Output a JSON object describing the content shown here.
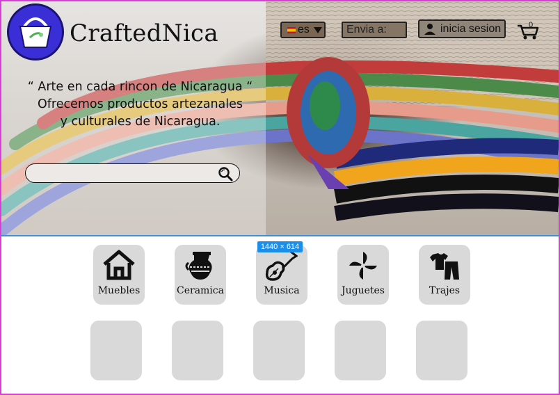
{
  "brand": {
    "name": "CraftedNica"
  },
  "header": {
    "language": "es",
    "ship_to_placeholder": "Envia a:",
    "login_label": "inicia sesion",
    "cart_count": "0"
  },
  "hero": {
    "tagline_line1": "“ Arte en cada rincon  de Nicaragua “",
    "tagline_line2": "Ofrecemos productos  artezanales",
    "tagline_line3": "y culturales de Nicaragua.",
    "search_placeholder": ""
  },
  "selection_badge": "1440 × 614",
  "categories": [
    {
      "label": "Muebles",
      "icon": "house-icon"
    },
    {
      "label": "Ceramica",
      "icon": "pottery-icon"
    },
    {
      "label": "Musica",
      "icon": "guitar-icon"
    },
    {
      "label": "Juguetes",
      "icon": "pinwheel-icon"
    },
    {
      "label": "Trajes",
      "icon": "clothes-icon"
    }
  ],
  "colors": {
    "accent": "#3a2fd6",
    "tile": "#d9d9d9",
    "frame": "#d63fd3",
    "divider": "#3b8fe0",
    "badge": "#1a8ee8"
  }
}
